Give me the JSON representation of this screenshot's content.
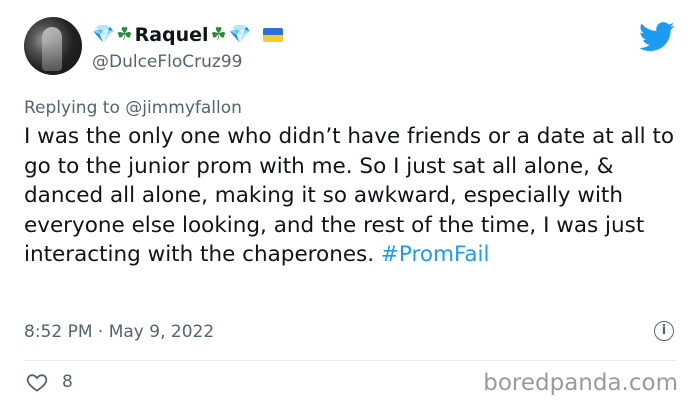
{
  "tweet": {
    "display_name": "Raquel",
    "handle": "@DulceFloCruz99",
    "replying_prefix": "Replying to",
    "replying_to": "@jimmyfallon",
    "text": "I was the only one who didn’t have friends or a date at all to go to the junior prom with me. So I just sat all alone, & danced all alone, making it so awkward, especially with everyone else looking, and the rest of the time, I was just interacting with the chaperones. ",
    "hashtag": "#PromFail",
    "timestamp": "8:52 PM · May 9, 2022",
    "like_count": "8"
  },
  "icons": {
    "platform": "twitter-bird-icon",
    "info": "info-icon",
    "like": "heart-icon"
  },
  "colors": {
    "link": "#1d9bf0",
    "secondary_text": "#536471",
    "primary_text": "#0f1419"
  },
  "watermark": "boredpanda.com"
}
